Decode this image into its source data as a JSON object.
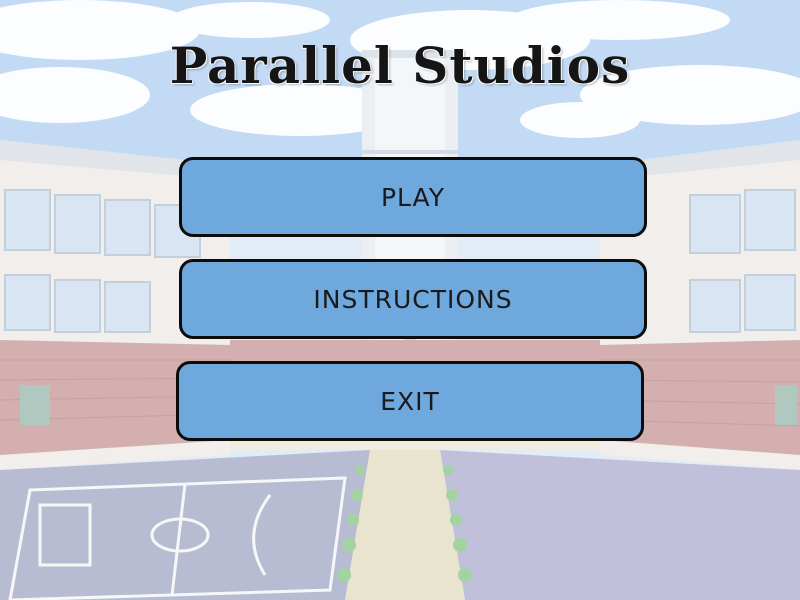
{
  "title": "Parallel Studios",
  "menu": {
    "play_label": "PLAY",
    "instructions_label": "INSTRUCTIONS",
    "exit_label": "EXIT"
  },
  "colors": {
    "button_fill": "#6fa8dc",
    "button_border": "#0c0c0c",
    "sky": "#9ec4ee",
    "court_left": "#8d93b8",
    "court_right": "#9a9ac6",
    "brick": "#b9807e"
  }
}
